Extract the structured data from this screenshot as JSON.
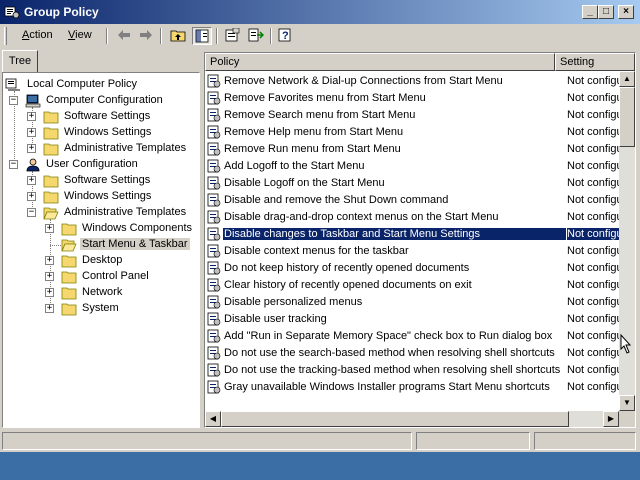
{
  "window": {
    "title": "Group Policy",
    "controls": {
      "minimize": "_",
      "maximize": "□",
      "close": "×"
    }
  },
  "menubar": {
    "action": {
      "underline": "A",
      "rest": "ction"
    },
    "view": {
      "underline": "V",
      "rest": "iew"
    }
  },
  "tabs": {
    "tree": "Tree"
  },
  "tree": {
    "root": "Local Computer Policy",
    "computer_config": "Computer Configuration",
    "cc_software": "Software Settings",
    "cc_windows": "Windows Settings",
    "cc_admin": "Administrative Templates",
    "user_config": "User Configuration",
    "uc_software": "Software Settings",
    "uc_windows": "Windows Settings",
    "uc_admin": "Administrative Templates",
    "windows_components": "Windows Components",
    "start_menu": "Start Menu & Taskbar",
    "desktop": "Desktop",
    "control_panel": "Control Panel",
    "network": "Network",
    "system": "System"
  },
  "list": {
    "headers": {
      "policy": "Policy",
      "setting": "Setting"
    },
    "selected_index": 9,
    "rows": [
      {
        "policy": "Remove Network & Dial-up Connections from Start Menu",
        "setting": "Not configured"
      },
      {
        "policy": "Remove Favorites menu from Start Menu",
        "setting": "Not configured"
      },
      {
        "policy": "Remove Search menu from Start Menu",
        "setting": "Not configured"
      },
      {
        "policy": "Remove Help menu from Start Menu",
        "setting": "Not configured"
      },
      {
        "policy": "Remove Run menu from Start Menu",
        "setting": "Not configured"
      },
      {
        "policy": "Add Logoff to the Start Menu",
        "setting": "Not configured"
      },
      {
        "policy": "Disable Logoff on the Start Menu",
        "setting": "Not configured"
      },
      {
        "policy": "Disable and remove the Shut Down command",
        "setting": "Not configured"
      },
      {
        "policy": "Disable drag-and-drop context menus on the Start Menu",
        "setting": "Not configured"
      },
      {
        "policy": "Disable changes to Taskbar and Start Menu Settings",
        "setting": "Not configured"
      },
      {
        "policy": "Disable context menus for the taskbar",
        "setting": "Not configured"
      },
      {
        "policy": "Do not keep history of recently opened documents",
        "setting": "Not configured"
      },
      {
        "policy": "Clear history of recently opened documents on exit",
        "setting": "Not configured"
      },
      {
        "policy": "Disable personalized menus",
        "setting": "Not configured"
      },
      {
        "policy": "Disable user tracking",
        "setting": "Not configured"
      },
      {
        "policy": "Add \"Run in Separate Memory Space\" check box to Run dialog box",
        "setting": "Not configured"
      },
      {
        "policy": "Do not use the search-based method when resolving shell shortcuts",
        "setting": "Not configured"
      },
      {
        "policy": "Do not use the tracking-based method when resolving shell shortcuts",
        "setting": "Not configured"
      },
      {
        "policy": "Gray unavailable Windows Installer programs Start Menu shortcuts",
        "setting": "Not configured"
      }
    ]
  },
  "icons": {
    "app": "group-policy-icon",
    "toolbar": [
      "back-arrow-icon",
      "forward-arrow-icon",
      "up-folder-icon",
      "show-hide-tree-icon",
      "properties-icon",
      "export-list-icon",
      "help-icon"
    ],
    "policy": "policy-setting-icon",
    "folder": "folder-icon",
    "open_folder": "open-folder-icon"
  },
  "colors": {
    "title_active": "#0a246a",
    "title_gradient_end": "#a6caf0",
    "selection": "#0a246a",
    "face": "#d4d0c8",
    "desktop": "#3a6ea5",
    "folder": "#f5d76e"
  }
}
